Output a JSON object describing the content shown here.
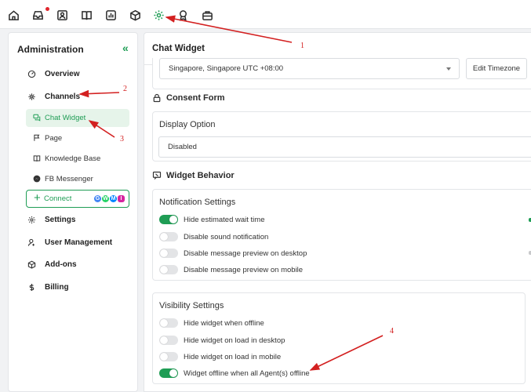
{
  "colors": {
    "accent": "#1f9d55",
    "annotation": "#d32020",
    "notification": "#e0262d"
  },
  "topnav": {
    "icons": [
      "home-icon",
      "inbox-icon",
      "contacts-icon",
      "knowledge-book-icon",
      "reports-icon",
      "package-icon",
      "settings-gear-icon",
      "award-icon",
      "briefcase-icon"
    ],
    "active": "settings-gear-icon"
  },
  "sidebar": {
    "title": "Administration",
    "collapse": "«",
    "items": {
      "overview": "Overview",
      "channels": "Channels",
      "chat_widget": "Chat Widget",
      "page": "Page",
      "knowledge_base": "Knowledge Base",
      "fb_messenger": "FB Messenger",
      "connect": "Connect",
      "settings": "Settings",
      "user_management": "User Management",
      "addons": "Add-ons",
      "billing": "Billing"
    },
    "connect_brands": [
      "G",
      "W",
      "M",
      "I"
    ]
  },
  "main": {
    "title": "Chat Widget",
    "timezone": {
      "value": "Singapore, Singapore UTC +08:00",
      "button": "Edit Timezone"
    },
    "consent_form": {
      "heading": "Consent Form",
      "label": "Display Option",
      "value": "Disabled"
    },
    "widget_behavior": {
      "heading": "Widget Behavior",
      "notification": {
        "label": "Notification Settings",
        "options": [
          {
            "label": "Hide estimated wait time",
            "on": true
          },
          {
            "label": "Disable sound notification",
            "on": false
          },
          {
            "label": "Disable message preview on desktop",
            "on": false
          },
          {
            "label": "Disable message preview on mobile",
            "on": false
          }
        ]
      },
      "visibility": {
        "label": "Visibility Settings",
        "options": [
          {
            "label": "Hide widget when offline",
            "on": false
          },
          {
            "label": "Hide widget on load in desktop",
            "on": false
          },
          {
            "label": "Hide widget on load in mobile",
            "on": false
          },
          {
            "label": "Widget offline when all Agent(s) offline",
            "on": true
          }
        ]
      }
    }
  },
  "annotations": [
    "1",
    "2",
    "3",
    "4"
  ]
}
